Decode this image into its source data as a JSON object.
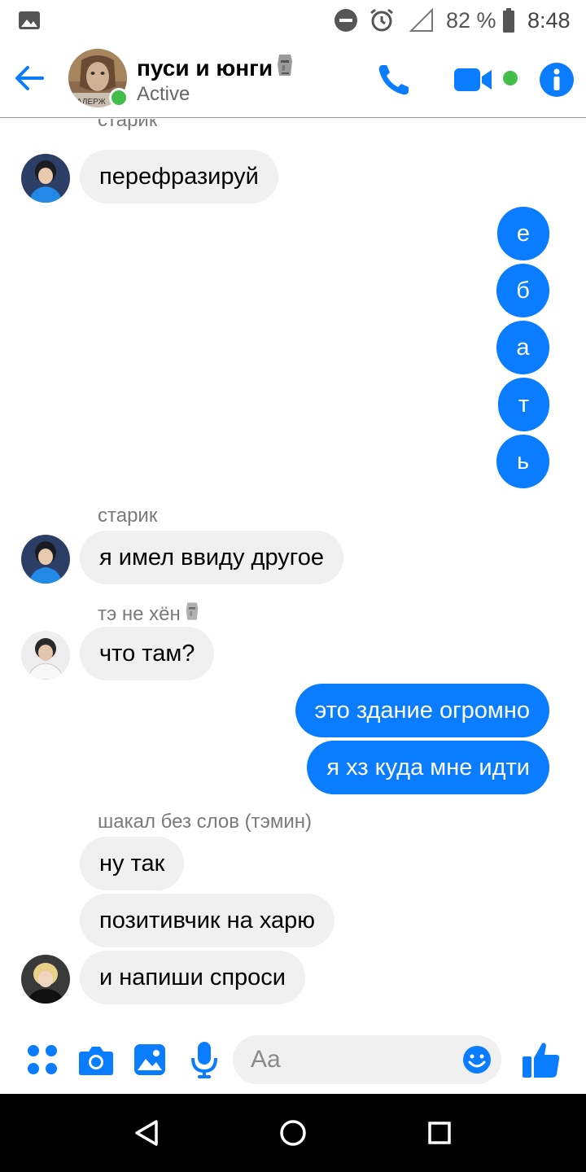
{
  "status_bar": {
    "battery_percent": "82 %",
    "time": "8:48",
    "icons": [
      "image-notification-icon",
      "do-not-disturb-icon",
      "alarm-icon",
      "signal-icon",
      "battery-icon"
    ]
  },
  "header": {
    "title": "пуси и юнги",
    "title_emoji": "moai-emoji",
    "status": "Active",
    "avatar_caption": "АЛЕРЖ"
  },
  "messages": {
    "cut_sender": "старик",
    "m1": {
      "sender": "",
      "text": "перефразируй"
    },
    "out_letters": [
      "е",
      "б",
      "а",
      "т",
      "ь"
    ],
    "m2": {
      "sender": "старик",
      "text": "я имел ввиду другое"
    },
    "m3": {
      "sender": "тэ не хён",
      "sender_emoji": "moai-emoji",
      "text": "что там?"
    },
    "out2": [
      "это здание огромно",
      "я хз куда мне идти"
    ],
    "group4": {
      "sender": "шакал без слов (тэмин)",
      "texts": [
        "ну так",
        "позитивчик на харю",
        "и напиши спроси"
      ]
    }
  },
  "composer": {
    "placeholder": "Aa"
  },
  "colors": {
    "accent": "#0a7cff",
    "incoming_bubble": "#f0f0f0",
    "online": "#44be4b"
  }
}
